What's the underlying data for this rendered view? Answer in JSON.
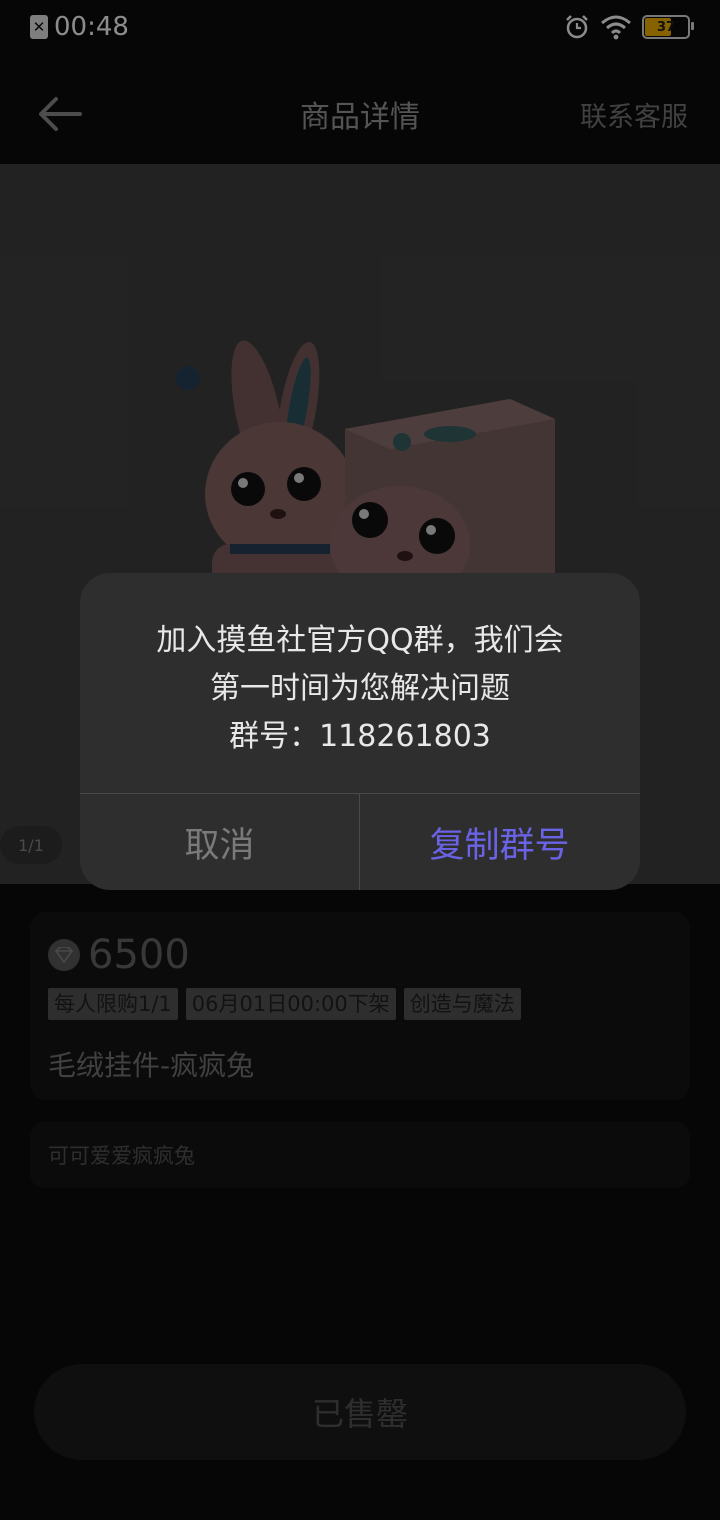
{
  "status_bar": {
    "time": "00:48",
    "battery": "37"
  },
  "nav": {
    "title": "商品详情",
    "service": "联系客服"
  },
  "gallery": {
    "counter": "1/1"
  },
  "product": {
    "price": "6500",
    "tags": [
      "每人限购1/1",
      "06月01日00:00下架",
      "创造与魔法"
    ],
    "name": "毛绒挂件-疯疯兔",
    "description": "可可爱爱疯疯兔"
  },
  "action": {
    "label": "已售罄"
  },
  "dialog": {
    "line1": "加入摸鱼社官方QQ群，我们会",
    "line2": "第一时间为您解决问题",
    "line3": "群号：118261803",
    "cancel": "取消",
    "confirm": "复制群号"
  },
  "colors": {
    "accent": "#6b63e6",
    "battery": "#f4b400"
  }
}
